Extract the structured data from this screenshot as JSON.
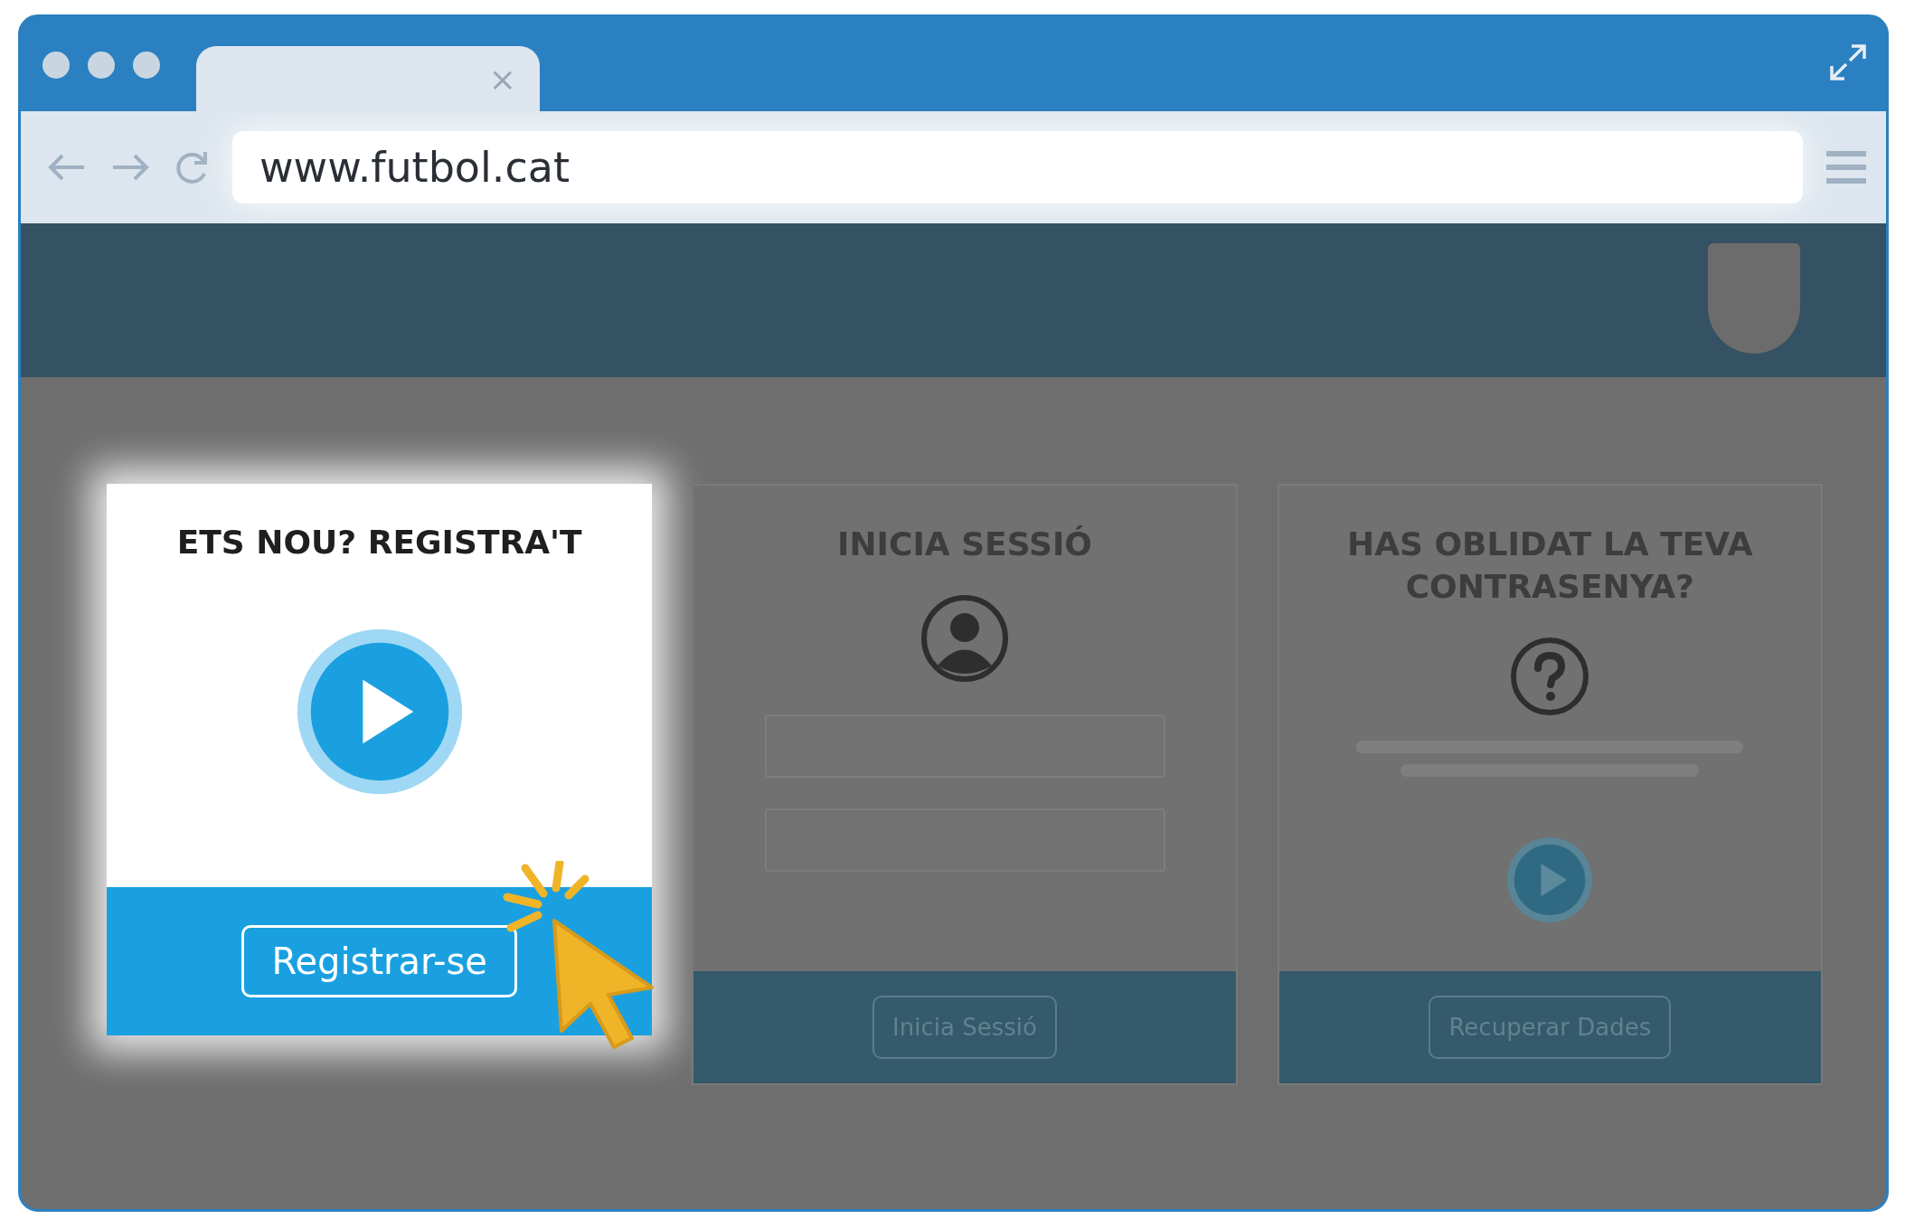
{
  "browser": {
    "tab_close": "×",
    "url": "www.futbol.cat"
  },
  "cards": [
    {
      "kind": "register",
      "title": "ETS NOU? REGISTRA'T",
      "button": "Registrar-se",
      "dimmed": false
    },
    {
      "kind": "login",
      "title": "INICIA SESSIÓ",
      "button": "Inicia Sessió",
      "dimmed": true
    },
    {
      "kind": "recover",
      "title": "HAS OBLIDAT LA TEVA CONTRASENYA?",
      "button": "Recuperar Dades",
      "dimmed": true
    }
  ]
}
